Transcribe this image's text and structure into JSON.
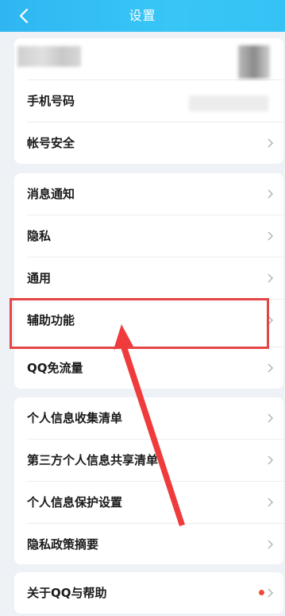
{
  "header": {
    "title": "设置"
  },
  "items": {
    "phone": "手机号码",
    "account_security": "帐号安全",
    "notifications": "消息通知",
    "privacy": "隐私",
    "general": "通用",
    "accessibility": "辅助功能",
    "qq_free_data": "QQ免流量",
    "personal_info_list": "个人信息收集清单",
    "third_party_sharing": "第三方个人信息共享清单",
    "personal_info_protection": "个人信息保护设置",
    "privacy_summary": "隐私政策摘要",
    "about_help": "关于QQ与帮助"
  },
  "colors": {
    "titlebar": "#35c2f5",
    "highlight": "#e64545",
    "arrow": "#ef3b3b"
  }
}
